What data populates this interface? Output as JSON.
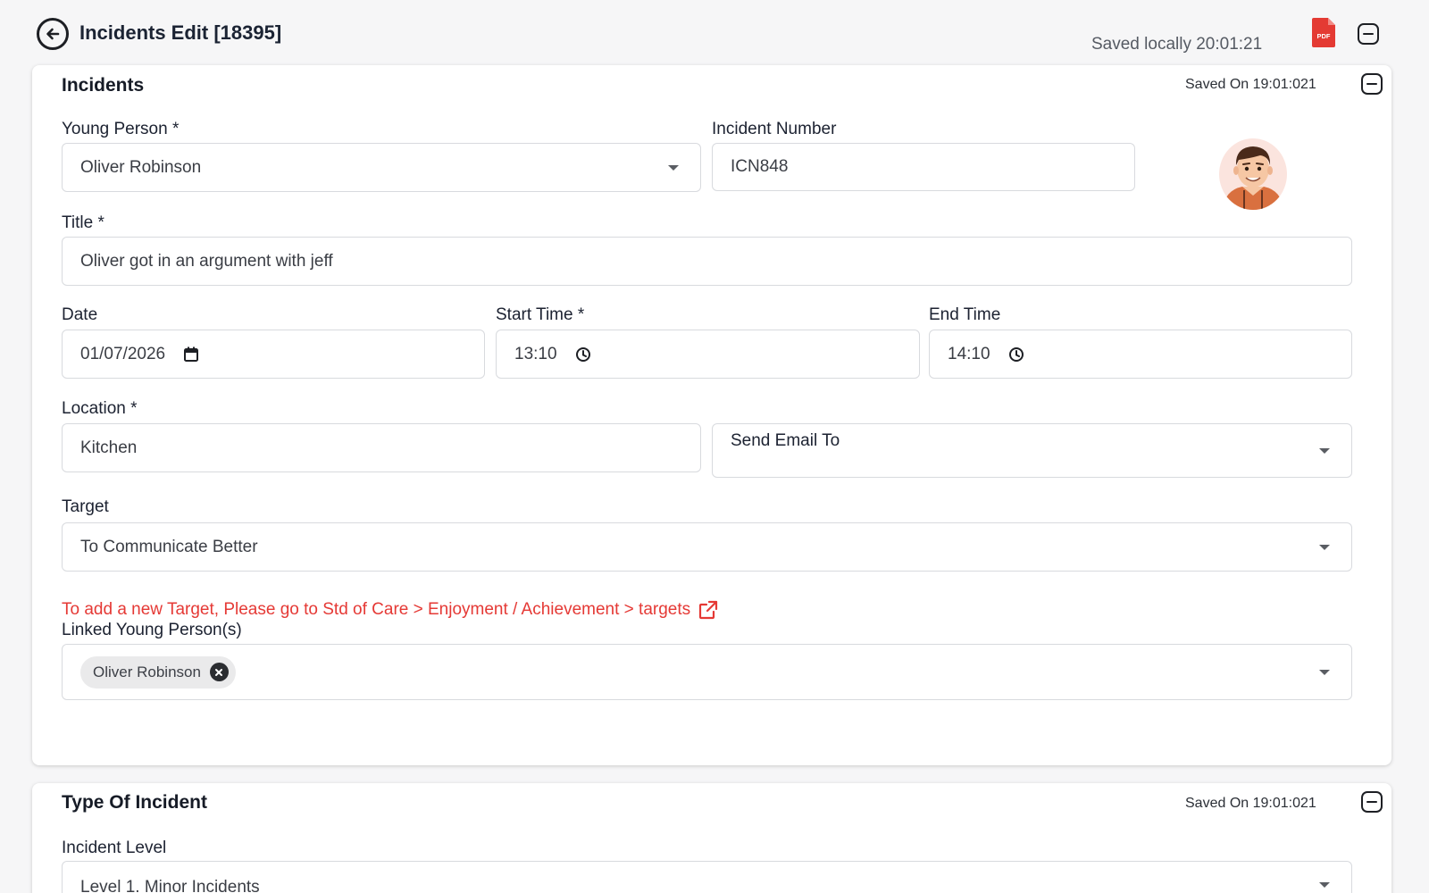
{
  "header": {
    "title": "Incidents Edit [18395]",
    "saved_locally": "Saved locally 20:01:21",
    "pdf_label": "PDF"
  },
  "incidents_section": {
    "title": "Incidents",
    "saved_on": "Saved On 19:01:021",
    "young_person": {
      "label": "Young Person *",
      "value": "Oliver Robinson"
    },
    "incident_number": {
      "label": "Incident Number",
      "value": "ICN848"
    },
    "title_field": {
      "label": "Title *",
      "value": "Oliver got in an argument with jeff"
    },
    "date": {
      "label": "Date",
      "value": "01/07/2026"
    },
    "start_time": {
      "label": "Start Time *",
      "value": "13:10"
    },
    "end_time": {
      "label": "End Time",
      "value": "14:10"
    },
    "location": {
      "label": "Location *",
      "value": "Kitchen"
    },
    "send_email": {
      "label": "Send Email To",
      "value": ""
    },
    "target": {
      "label": "Target",
      "value": "To Communicate Better"
    },
    "target_hint": "To add a new Target, Please go to Std of Care > Enjoyment / Achievement > targets",
    "linked": {
      "label": "Linked Young Person(s)",
      "chips": [
        "Oliver Robinson"
      ]
    }
  },
  "type_section": {
    "title": "Type Of Incident",
    "saved_on": "Saved On 19:01:021",
    "incident_level": {
      "label": "Incident Level",
      "value": "Level 1. Minor Incidents"
    }
  },
  "colors": {
    "accent_red": "#e53935",
    "pdf_red": "#e43a33",
    "text_dark": "#1b2333"
  }
}
